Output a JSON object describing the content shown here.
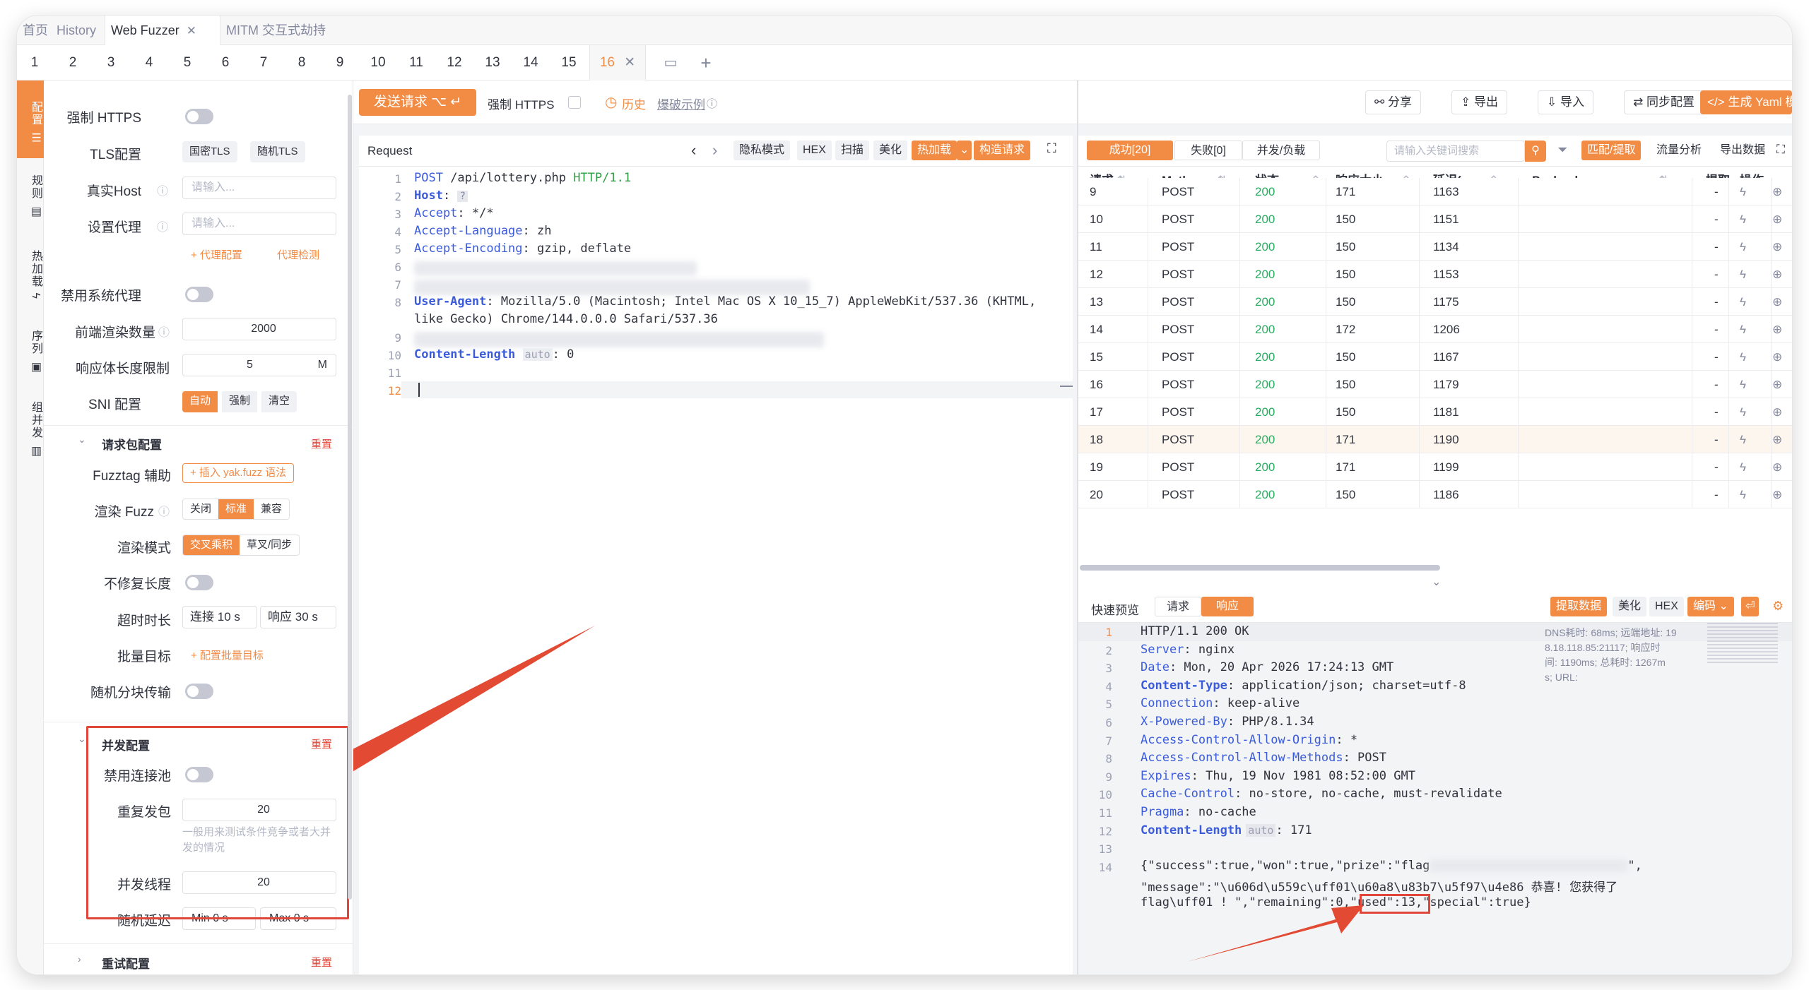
{
  "top_tabs": [
    {
      "label": "首页",
      "closable": false
    },
    {
      "label": "History",
      "closable": false
    },
    {
      "label": "Web Fuzzer",
      "closable": true,
      "active": true
    },
    {
      "label": "MITM 交互式劫持",
      "closable": true
    }
  ],
  "sub_tabs": [
    "1",
    "2",
    "3",
    "4",
    "5",
    "6",
    "7",
    "8",
    "9",
    "10",
    "11",
    "12",
    "13",
    "14",
    "15",
    "16"
  ],
  "active_sub_tab": "16",
  "rail": [
    {
      "label": "配置",
      "icon": "sliders-icon"
    },
    {
      "label": "规则",
      "icon": "rule-icon"
    },
    {
      "label": "热加载",
      "icon": "bolt-icon"
    },
    {
      "label": "序列",
      "icon": "sequence-icon"
    },
    {
      "label": "组并发",
      "icon": "grid-icon"
    }
  ],
  "sidebar": {
    "force_https": "强制 HTTPS",
    "tls_label": "TLS配置",
    "tls_opts": [
      "国密TLS",
      "随机TLS"
    ],
    "real_host": "真实Host",
    "real_host_ph": "请输入...",
    "proxy": "设置代理",
    "proxy_ph": "请输入...",
    "proxy_cfg": "+ 代理配置",
    "proxy_check": "代理检测",
    "disable_sys_proxy": "禁用系统代理",
    "front_render": "前端渲染数量",
    "front_render_val": "2000",
    "resp_limit": "响应体长度限制",
    "resp_limit_val": "5",
    "resp_limit_unit": "M",
    "sni": "SNI 配置",
    "sni_opts": [
      "自动",
      "强制",
      "清空"
    ],
    "req_pkg_cfg": "请求包配置",
    "reset": "重置",
    "fuzztag": "Fuzztag 辅助",
    "fuzztag_btn": "+ 插入 yak.fuzz 语法",
    "render_fuzz": "渲染 Fuzz",
    "render_fuzz_opts": [
      "关闭",
      "标准",
      "兼容"
    ],
    "render_mode": "渲染模式",
    "render_mode_opts": [
      "交叉乘积",
      "草叉/同步"
    ],
    "no_fix_len": "不修复长度",
    "timeout": "超时时长",
    "conn_timeout": "连接",
    "conn_timeout_val": "10",
    "resp_timeout": "响应",
    "resp_timeout_val": "30",
    "sec": "s",
    "batch_target": "批量目标",
    "batch_target_btn": "+ 配置批量目标",
    "chunked": "随机分块传输",
    "concurrency_cfg": "并发配置",
    "disable_pool": "禁用连接池",
    "repeat": "重复发包",
    "repeat_val": "20",
    "repeat_hint": "一般用来测试条件竞争或者大并发的情况",
    "threads": "并发线程",
    "threads_val": "20",
    "random_delay": "随机延迟",
    "min": "Min",
    "min_val": "0",
    "max": "Max",
    "max_val": "0",
    "retry_cfg": "重试配置"
  },
  "toolbar": {
    "send": "发送请求 ⌥ ↵",
    "force_https": "强制 HTTPS",
    "history": "历史",
    "blast_example": "爆破示例",
    "share": "分享",
    "export": "导出",
    "import": "导入",
    "sync": "同步配置",
    "gen_yaml": "生成 Yaml 模板"
  },
  "request_panel": {
    "title": "Request",
    "buttons": [
      "隐私模式",
      "HEX",
      "扫描",
      "美化",
      "热加载",
      "构造请求"
    ],
    "lines": [
      {
        "n": "1",
        "key": "POST",
        "val": " /api/lottery.php ",
        "extra": "HTTP/1.1"
      },
      {
        "n": "2",
        "key": "Host",
        "val": ": "
      },
      {
        "n": "3",
        "key": "Accept",
        "val": ": */*"
      },
      {
        "n": "4",
        "key": "Accept-Language",
        "val": ": zh"
      },
      {
        "n": "5",
        "key": "Accept-Encoding",
        "val": ": gzip, deflate"
      },
      {
        "n": "6",
        "key": "",
        "val": ""
      },
      {
        "n": "7",
        "key": "",
        "val": ""
      },
      {
        "n": "8",
        "key": "User-Agent",
        "val": ": Mozilla/5.0 (Macintosh; Intel Mac OS X 10_15_7) AppleWebKit/537.36 (KHTML,"
      },
      {
        "n": "",
        "key": "",
        "val": "like Gecko) Chrome/144.0.0.0 Safari/537.36"
      },
      {
        "n": "9",
        "key": "",
        "val": ""
      },
      {
        "n": "10",
        "key": "Content-Length",
        "val": ": 0",
        "badge": "auto"
      },
      {
        "n": "11",
        "key": "",
        "val": ""
      },
      {
        "n": "12",
        "key": "",
        "val": ""
      }
    ]
  },
  "results": {
    "tabs": [
      "成功[20]",
      "失败[0]",
      "并发/负载"
    ],
    "search_ph": "请输入关键词搜索",
    "buttons": [
      "匹配/提取",
      "流量分析",
      "导出数据"
    ],
    "columns": [
      "请求",
      "Meth...",
      "状态",
      "响应大小",
      "延迟(...",
      "Payloads",
      "提取",
      "操作"
    ],
    "rows": [
      {
        "id": "9",
        "method": "POST",
        "status": "200",
        "size": "171",
        "delay": "1163",
        "extract": "-"
      },
      {
        "id": "10",
        "method": "POST",
        "status": "200",
        "size": "150",
        "delay": "1151",
        "extract": "-"
      },
      {
        "id": "11",
        "method": "POST",
        "status": "200",
        "size": "150",
        "delay": "1134",
        "extract": "-"
      },
      {
        "id": "12",
        "method": "POST",
        "status": "200",
        "size": "150",
        "delay": "1153",
        "extract": "-"
      },
      {
        "id": "13",
        "method": "POST",
        "status": "200",
        "size": "150",
        "delay": "1175",
        "extract": "-"
      },
      {
        "id": "14",
        "method": "POST",
        "status": "200",
        "size": "172",
        "delay": "1206",
        "extract": "-"
      },
      {
        "id": "15",
        "method": "POST",
        "status": "200",
        "size": "150",
        "delay": "1167",
        "extract": "-"
      },
      {
        "id": "16",
        "method": "POST",
        "status": "200",
        "size": "150",
        "delay": "1179",
        "extract": "-"
      },
      {
        "id": "17",
        "method": "POST",
        "status": "200",
        "size": "150",
        "delay": "1181",
        "extract": "-"
      },
      {
        "id": "18",
        "method": "POST",
        "status": "200",
        "size": "171",
        "delay": "1190",
        "extract": "-",
        "selected": true
      },
      {
        "id": "19",
        "method": "POST",
        "status": "200",
        "size": "171",
        "delay": "1199",
        "extract": "-"
      },
      {
        "id": "20",
        "method": "POST",
        "status": "200",
        "size": "150",
        "delay": "1186",
        "extract": "-"
      }
    ]
  },
  "preview": {
    "title": "快速预览",
    "tabs": [
      "请求",
      "响应"
    ],
    "buttons": [
      "提取数据",
      "美化",
      "HEX",
      "编码"
    ],
    "meta": [
      "DNS耗时: 68ms; 远端地址: 19",
      "8.18.118.85:21117; 响应时",
      "间: 1190ms; 总耗时: 1267m",
      "s; URL:"
    ],
    "lines": [
      {
        "n": "1",
        "key": "",
        "val": "HTTP/1.1 200 OK"
      },
      {
        "n": "2",
        "key": "Server",
        "val": ": nginx"
      },
      {
        "n": "3",
        "key": "Date",
        "val": ": Mon, 20 Apr 2026 17:24:13 GMT"
      },
      {
        "n": "4",
        "key": "Content-Type",
        "val": ": application/json; charset=utf-8",
        "bold": true
      },
      {
        "n": "5",
        "key": "Connection",
        "val": ": keep-alive"
      },
      {
        "n": "6",
        "key": "X-Powered-By",
        "val": ": PHP/8.1.34"
      },
      {
        "n": "7",
        "key": "Access-Control-Allow-Origin",
        "val": ": *"
      },
      {
        "n": "8",
        "key": "Access-Control-Allow-Methods",
        "val": ": POST"
      },
      {
        "n": "9",
        "key": "Expires",
        "val": ": Thu, 19 Nov 1981 08:52:00 GMT"
      },
      {
        "n": "10",
        "key": "Cache-Control",
        "val": ": no-store, no-cache, must-revalidate"
      },
      {
        "n": "11",
        "key": "Pragma",
        "val": ": no-cache"
      },
      {
        "n": "12",
        "key": "Content-Length",
        "val": ": 171",
        "badge": "auto",
        "bold": true
      },
      {
        "n": "13",
        "key": "",
        "val": ""
      },
      {
        "n": "14",
        "key": "",
        "val": ""
      }
    ],
    "json_lines": [
      "{\"success\":true,\"won\":true,\"prize\":\"flag",
      "\"message\":\"\\u606d\\u559c\\uff01\\u60a8\\u83b7\\u5f97\\u4e86 恭喜! 您获得了",
      "flag\\uff01 ! \",\"remaining\":0,\"used\":13,\"special\":true}"
    ]
  },
  "colors": {
    "accent": "#f28b44",
    "success": "#27ae60",
    "annotation": "#e0463a"
  }
}
